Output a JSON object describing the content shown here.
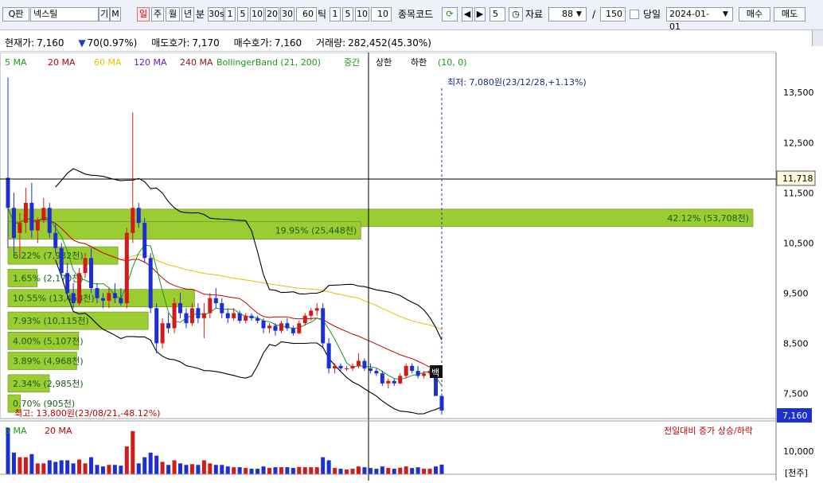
{
  "toolbar": {
    "search_label": "Q판",
    "stock_name": "넥스틸",
    "btn_gi": "기",
    "btn_m": "M",
    "periods": [
      "일",
      "주",
      "월",
      "년",
      "분"
    ],
    "minute_label": "30s",
    "intervals": [
      "1",
      "5",
      "10",
      "20",
      "30"
    ],
    "tick_value": "60",
    "tick_label": "틱",
    "tick_intervals": [
      "1",
      "5",
      "10"
    ],
    "tick_input": "10",
    "code_label": "종목코드",
    "step_value": "5",
    "data_label": "자료",
    "data_count": "88",
    "data_total": "150",
    "slash": "/",
    "today_label": "당일",
    "date": "2024-01-01",
    "buy_label": "매수",
    "sell_label": "매도"
  },
  "quote": {
    "current_label": "현재가:",
    "current_value": "7,160",
    "change_value": "70(0.97%)",
    "ask_label": "매도호가:",
    "ask_value": "7,170",
    "bid_label": "매수호가:",
    "bid_value": "7,160",
    "volume_label": "거래량:",
    "volume_value": "282,452(45.30%)"
  },
  "legend": {
    "ma5": "5 MA",
    "ma20": "20 MA",
    "ma60": "60 MA",
    "ma120": "120 MA",
    "ma240": "240 MA",
    "bb": "BollingerBand (21, 200)",
    "mid": "중간",
    "upper": "상한",
    "lower": "하한",
    "params": "(10, 0)"
  },
  "annotations": {
    "low": "최저: 7,080원(23/12/28,+1.13%)",
    "high": "최고: 13,800원(23/08/21,-48.12%)",
    "baek": "백",
    "crosshair_price": "11,718",
    "current_price_tag": "7,160"
  },
  "yaxis": [
    "13,500",
    "12,500",
    "11,500",
    "10,500",
    "9,500",
    "8,500",
    "7,500"
  ],
  "volume_axis": [
    "10,000"
  ],
  "volume_legend": {
    "ma5": "5 MA",
    "ma20": "20 MA",
    "note": "전일대비 증가 상승/하락",
    "unit": "[천주]"
  },
  "colors": {
    "up": "#d11a1a",
    "down": "#1c2fd1",
    "profile": "#9acd32",
    "ma5": "#1a9a1a",
    "ma20": "#c00000",
    "ma60": "#e8c000",
    "ma120": "#6a1ac0",
    "ma240": "#8b1a1a"
  },
  "chart_data": {
    "type": "candlestick",
    "ylim": [
      7000,
      13800
    ],
    "volume_profile": [
      {
        "price": 11000,
        "label": "42.12% (53,708천)",
        "pct": 42.12
      },
      {
        "price": 10750,
        "label": "19.95% (25,448천)",
        "pct": 19.95
      },
      {
        "price": 10250,
        "label": "6.22% (7,932천)",
        "pct": 6.22
      },
      {
        "price": 9800,
        "label": "1.65% (2,170천)",
        "pct": 1.65
      },
      {
        "price": 9400,
        "label": "10.55% (13,458천)",
        "pct": 10.55
      },
      {
        "price": 8950,
        "label": "7.93% (10,115천)",
        "pct": 7.93
      },
      {
        "price": 8550,
        "label": "4.00% (5,107천)",
        "pct": 4.0
      },
      {
        "price": 8150,
        "label": "3.89% (4,968천)",
        "pct": 3.89
      },
      {
        "price": 7700,
        "label": "2.34% (2,985천)",
        "pct": 2.34
      },
      {
        "price": 7300,
        "label": "0.70% (905천)",
        "pct": 0.7
      }
    ],
    "candles": [
      [
        11800,
        13800,
        10400,
        11200
      ],
      [
        11200,
        11500,
        10300,
        10600
      ],
      [
        10700,
        11100,
        10200,
        10900
      ],
      [
        10900,
        11600,
        10700,
        11300
      ],
      [
        11300,
        11700,
        10600,
        10750
      ],
      [
        10750,
        11000,
        10500,
        10950
      ],
      [
        10950,
        11400,
        10900,
        11200
      ],
      [
        11200,
        11300,
        10600,
        10700
      ],
      [
        10700,
        10900,
        10300,
        10400
      ],
      [
        10400,
        10500,
        9800,
        9900
      ],
      [
        9900,
        10100,
        9400,
        9500
      ],
      [
        9500,
        9700,
        9200,
        9300
      ],
      [
        9300,
        10000,
        9250,
        9900
      ],
      [
        9900,
        10300,
        9800,
        10200
      ],
      [
        10200,
        10400,
        9500,
        9600
      ],
      [
        9600,
        9700,
        9300,
        9400
      ],
      [
        9400,
        9500,
        9200,
        9350
      ],
      [
        9350,
        9600,
        9200,
        9500
      ],
      [
        9500,
        9700,
        9300,
        9400
      ],
      [
        9400,
        9600,
        9250,
        9300
      ],
      [
        9300,
        10800,
        9200,
        10700
      ],
      [
        10700,
        13100,
        10500,
        11200
      ],
      [
        11200,
        11300,
        10800,
        10900
      ],
      [
        10900,
        11000,
        10100,
        10200
      ],
      [
        10200,
        10300,
        9100,
        9200
      ],
      [
        9200,
        9300,
        8300,
        8500
      ],
      [
        8500,
        9000,
        8400,
        8900
      ],
      [
        8900,
        9100,
        8700,
        8800
      ],
      [
        8800,
        9400,
        8700,
        9300
      ],
      [
        9300,
        9500,
        9000,
        9100
      ],
      [
        9100,
        9200,
        8800,
        8900
      ],
      [
        8900,
        9300,
        8850,
        9200
      ],
      [
        9200,
        9300,
        8900,
        9000
      ],
      [
        9000,
        9300,
        8600,
        9100
      ],
      [
        9100,
        9500,
        9000,
        9400
      ],
      [
        9400,
        9600,
        9200,
        9300
      ],
      [
        9300,
        9400,
        9000,
        9100
      ],
      [
        9100,
        9200,
        8900,
        9000
      ],
      [
        9000,
        9200,
        8950,
        9100
      ],
      [
        9100,
        9150,
        8900,
        8950
      ],
      [
        8950,
        9100,
        8900,
        9050
      ],
      [
        9050,
        9100,
        8950,
        9000
      ],
      [
        9000,
        9050,
        8900,
        8950
      ],
      [
        8950,
        9000,
        8700,
        8800
      ],
      [
        8800,
        8900,
        8700,
        8850
      ],
      [
        8850,
        8900,
        8650,
        8750
      ],
      [
        8750,
        8950,
        8700,
        8900
      ],
      [
        8900,
        9000,
        8750,
        8800
      ],
      [
        8800,
        8850,
        8650,
        8700
      ],
      [
        8700,
        8950,
        8680,
        8900
      ],
      [
        8900,
        9100,
        8850,
        9050
      ],
      [
        9050,
        9200,
        8950,
        9150
      ],
      [
        9150,
        9300,
        9050,
        9200
      ],
      [
        9200,
        9300,
        8400,
        8500
      ],
      [
        8500,
        8600,
        7900,
        8000
      ],
      [
        8000,
        8100,
        7900,
        8050
      ],
      [
        8050,
        8100,
        7950,
        8000
      ],
      [
        8000,
        8050,
        7950,
        8000
      ],
      [
        8000,
        8100,
        7950,
        8050
      ],
      [
        8050,
        8300,
        8000,
        8150
      ],
      [
        8150,
        8200,
        7950,
        8000
      ],
      [
        8000,
        8100,
        7900,
        7950
      ],
      [
        7950,
        8000,
        7850,
        7900
      ],
      [
        7900,
        7950,
        7650,
        7700
      ],
      [
        7700,
        7800,
        7600,
        7750
      ],
      [
        7750,
        7800,
        7650,
        7700
      ],
      [
        7700,
        7900,
        7680,
        7850
      ],
      [
        7850,
        8100,
        7800,
        8050
      ],
      [
        8050,
        8100,
        7900,
        7950
      ],
      [
        7950,
        8050,
        7800,
        7850
      ],
      [
        7850,
        7950,
        7800,
        7900
      ],
      [
        7900,
        8000,
        7850,
        7950
      ],
      [
        7950,
        8000,
        7700,
        7450
      ],
      [
        7450,
        7500,
        7080,
        7160
      ]
    ]
  }
}
